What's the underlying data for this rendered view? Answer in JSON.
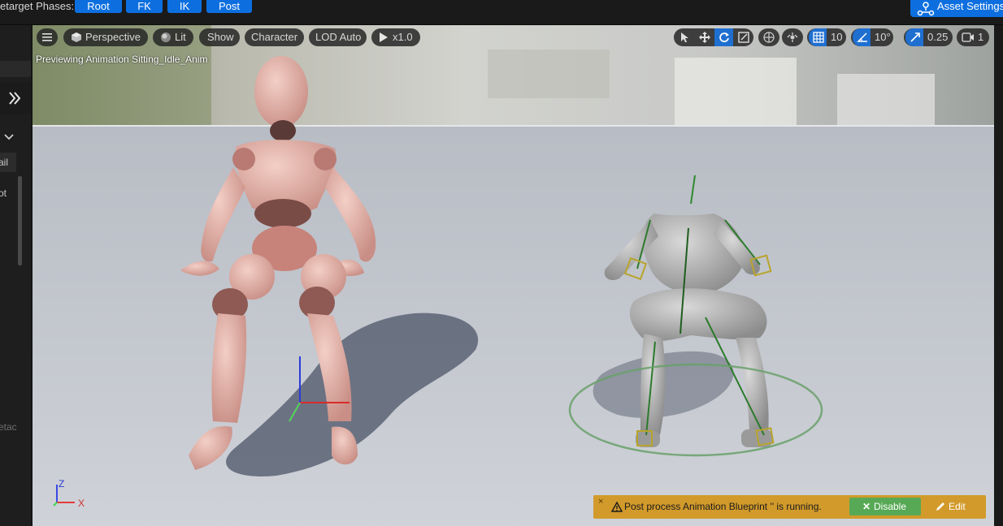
{
  "toolbar": {
    "phases_label": "etarget Phases:",
    "phases": [
      "Root",
      "FK",
      "IK",
      "Post"
    ],
    "asset_settings": "Asset Settings",
    "accent": "#0d6fdf"
  },
  "left_panel": {
    "items": [
      "ail",
      "ot",
      "etac"
    ]
  },
  "viewport": {
    "menu_icon": "hamburger-icon",
    "perspective": "Perspective",
    "lit": "Lit",
    "show": "Show",
    "character": "Character",
    "lod": "LOD Auto",
    "play_speed": "x1.0",
    "grid_snap": "10",
    "rotation_snap": "10°",
    "scale_snap": "0.25",
    "camera_speed": "1",
    "preview_text": "Previewing Animation Sitting_Idle_Anim",
    "axis_z": "Z",
    "axis_x": "X"
  },
  "notification": {
    "close": "×",
    "message": "Post process Animation Blueprint '' is running.",
    "disable": "Disable",
    "edit": "Edit",
    "color": "#d29a2b",
    "disable_color": "#57a955"
  }
}
